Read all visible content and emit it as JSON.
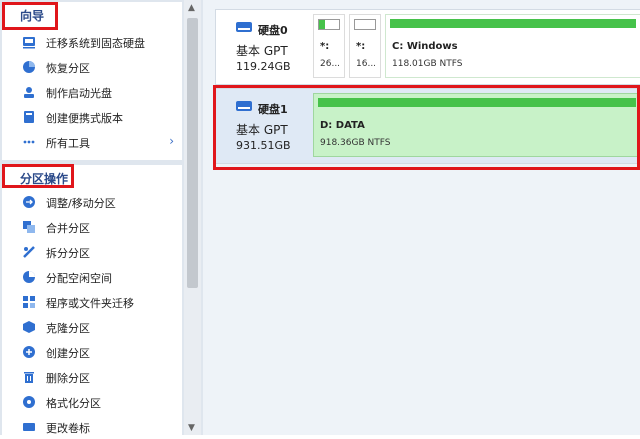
{
  "guide_panel": {
    "title": "向导",
    "items": [
      {
        "label": "迁移系统到固态硬盘",
        "icon": "migrate-disk-icon"
      },
      {
        "label": "恢复分区",
        "icon": "partition-recovery-icon"
      },
      {
        "label": "制作启动光盘",
        "icon": "boot-disc-icon"
      },
      {
        "label": "创建便携式版本",
        "icon": "portable-version-icon"
      },
      {
        "label": "所有工具",
        "icon": "more-dots-icon",
        "chevron": "›"
      }
    ]
  },
  "partition_panel": {
    "title": "分区操作",
    "items": [
      {
        "label": "调整/移动分区",
        "icon": "resize-partition-icon"
      },
      {
        "label": "合并分区",
        "icon": "merge-partition-icon"
      },
      {
        "label": "拆分分区",
        "icon": "split-partition-icon"
      },
      {
        "label": "分配空闲空间",
        "icon": "allocate-space-icon"
      },
      {
        "label": "程序或文件夹迁移",
        "icon": "app-mover-icon"
      },
      {
        "label": "克隆分区",
        "icon": "clone-partition-icon"
      },
      {
        "label": "创建分区",
        "icon": "create-partition-icon"
      },
      {
        "label": "删除分区",
        "icon": "delete-partition-icon"
      },
      {
        "label": "格式化分区",
        "icon": "format-partition-icon"
      },
      {
        "label": "更改卷标",
        "icon": "change-label-icon"
      }
    ]
  },
  "disks": [
    {
      "name": "硬盘0",
      "type": "基本 GPT",
      "size": "119.24GB",
      "partitions": [
        {
          "label": "*:",
          "size": "26...",
          "usage": 0.3
        },
        {
          "label": "*:",
          "size": "16...",
          "usage": 0.0
        },
        {
          "label": "C: Windows",
          "size": "118.01GB NTFS",
          "usage": 1.0
        }
      ]
    },
    {
      "name": "硬盘1",
      "type": "基本 GPT",
      "size": "931.51GB",
      "partitions": [
        {
          "label": "D: DATA",
          "size": "918.36GB NTFS",
          "usage": 1.0
        }
      ]
    }
  ],
  "colors": {
    "highlight": "#e0161b",
    "usage_fill": "#46c24a",
    "partition_fill": "#c8f2c8",
    "accent": "#3b6fc6"
  }
}
